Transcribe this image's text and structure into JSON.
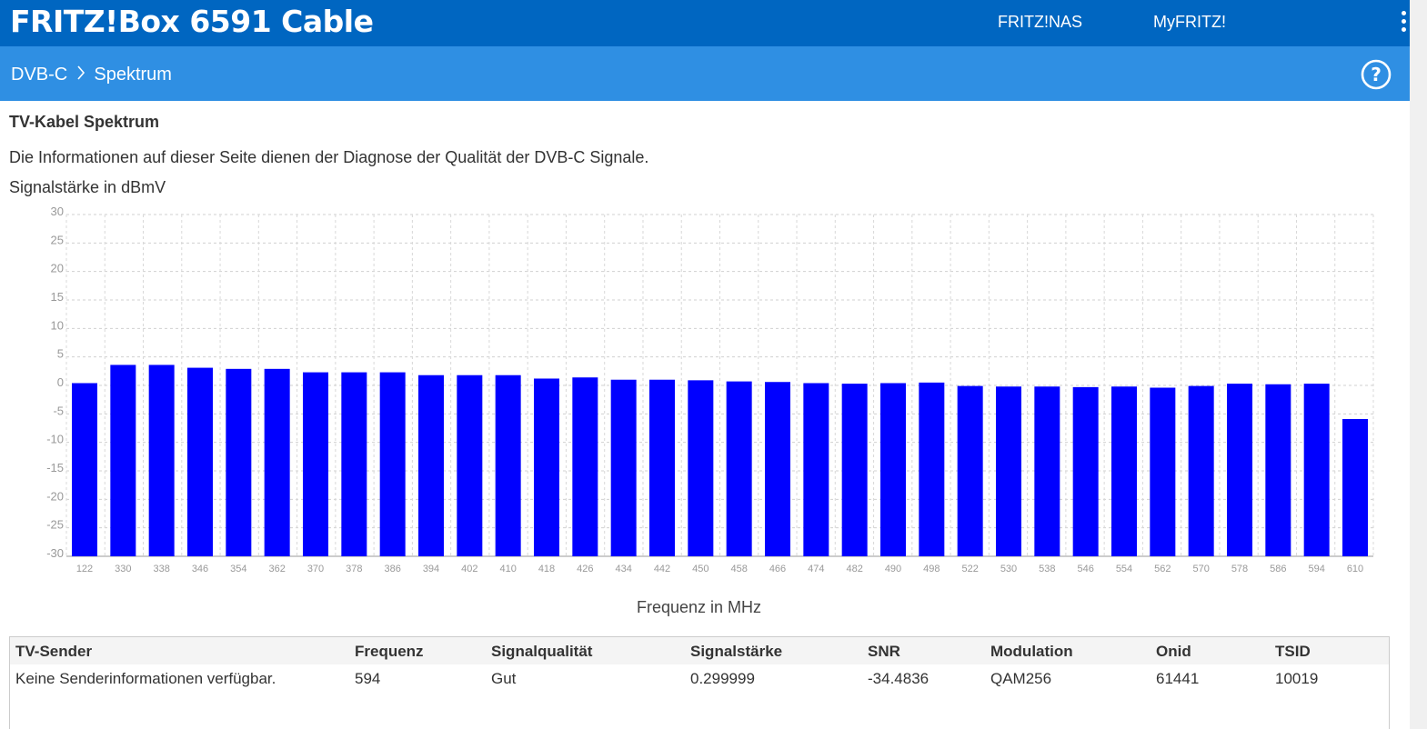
{
  "header": {
    "brand": "FRITZ!Box 6591 Cable",
    "links": [
      "FRITZ!NAS",
      "MyFRITZ!"
    ]
  },
  "breadcrumb": {
    "parent": "DVB-C",
    "current": "Spektrum"
  },
  "page": {
    "title": "TV-Kabel Spektrum",
    "description": "Die Informationen auf dieser Seite dienen der Diagnose der Qualität der DVB-C Signale.",
    "unit_label": "Signalstärke in dBmV"
  },
  "chart_data": {
    "type": "bar",
    "title": "",
    "ylabel": "Signalstärke in dBmV",
    "xlabel": "Frequenz in MHz",
    "ylim": [
      -30,
      30
    ],
    "yticks": [
      30,
      25,
      20,
      15,
      10,
      5,
      0,
      -5,
      -10,
      -15,
      -20,
      -25,
      -30
    ],
    "grid": true,
    "bar_color": "#0000ff",
    "categories": [
      "122",
      "330",
      "338",
      "346",
      "354",
      "362",
      "370",
      "378",
      "386",
      "394",
      "402",
      "410",
      "418",
      "426",
      "434",
      "442",
      "450",
      "458",
      "466",
      "474",
      "482",
      "490",
      "498",
      "522",
      "530",
      "538",
      "546",
      "554",
      "562",
      "570",
      "578",
      "586",
      "594",
      "610"
    ],
    "values": [
      0.4,
      3.6,
      3.6,
      3.1,
      2.9,
      2.9,
      2.3,
      2.3,
      2.3,
      1.8,
      1.8,
      1.8,
      1.2,
      1.4,
      1.0,
      1.0,
      0.9,
      0.7,
      0.6,
      0.4,
      0.3,
      0.4,
      0.5,
      -0.1,
      -0.2,
      -0.2,
      -0.3,
      -0.2,
      -0.4,
      -0.1,
      0.3,
      0.2,
      0.3,
      -5.9
    ]
  },
  "table": {
    "headers": [
      "TV-Sender",
      "Frequenz",
      "Signalqualität",
      "Signalstärke",
      "SNR",
      "Modulation",
      "Onid",
      "TSID"
    ],
    "rows": [
      [
        "Keine Senderinformationen verfügbar.",
        "594",
        "Gut",
        "0.299999",
        "-34.4836",
        "QAM256",
        "61441",
        "10019"
      ]
    ]
  },
  "icons": {
    "help": "help-circle-icon",
    "menu": "kebab-menu-icon",
    "separator": "chevron-right-icon"
  },
  "colors": {
    "topbar": "#0066c1",
    "subbar": "#2f8fe3",
    "bars": "#0000ff"
  }
}
